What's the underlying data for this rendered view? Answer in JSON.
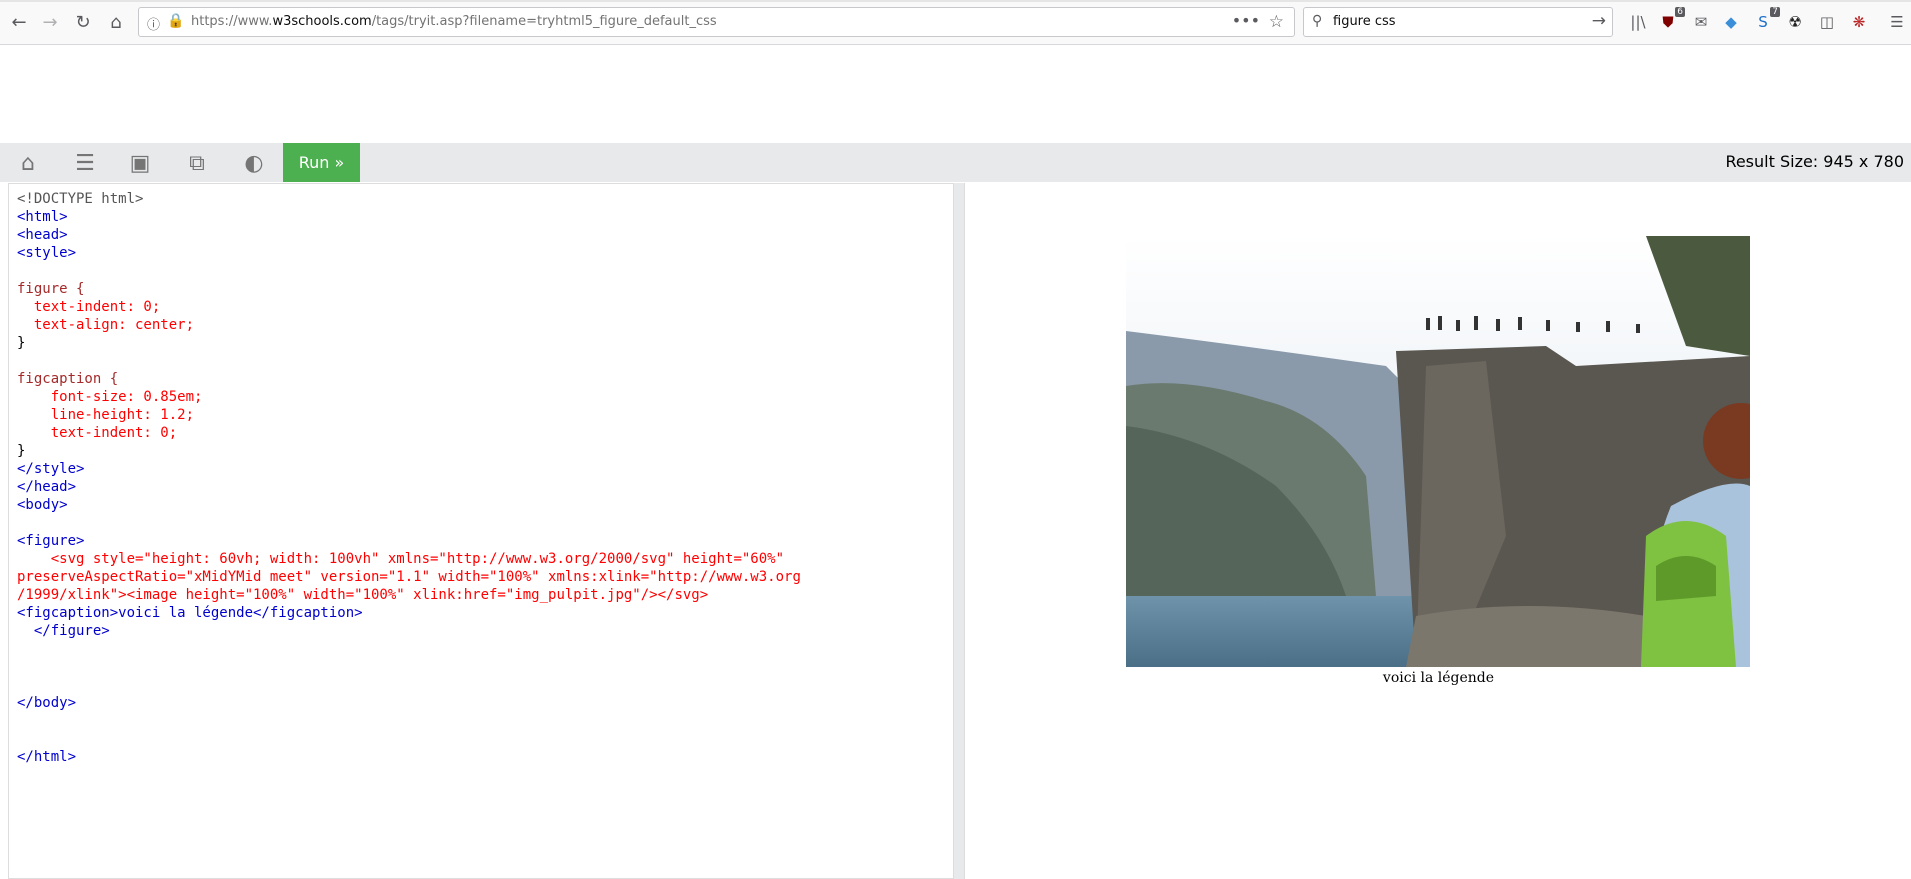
{
  "browser": {
    "url_prefix": "https://www.",
    "url_host": "w3schools.com",
    "url_path": "/tags/tryit.asp?filename=tryhtml5_figure_default_css",
    "search_query": "figure css",
    "badges": {
      "ublock": "6",
      "notifications": "7"
    }
  },
  "toolbar": {
    "run_label": "Run »",
    "result_size": "Result Size: 945 x 780"
  },
  "code_lines": [
    "<!DOCTYPE html>",
    "<html>",
    "<head>",
    "<style>",
    "",
    "figure {",
    "  text-indent: 0;",
    "  text-align: center;",
    "}",
    "",
    "figcaption {",
    "    font-size: 0.85em;",
    "    line-height: 1.2;",
    "    text-indent: 0;",
    "}",
    "</style>",
    "</head>",
    "<body>",
    "",
    "<figure>",
    "    <svg style=\"height: 60vh; width: 100vh\" xmlns=\"http://www.w3.org/2000/svg\" height=\"60%\"",
    "preserveAspectRatio=\"xMidYMid meet\" version=\"1.1\" width=\"100%\" xmlns:xlink=\"http://www.w3.org",
    "/1999/xlink\"><image height=\"100%\" width=\"100%\" xlink:href=\"img_pulpit.jpg\"/></svg>",
    "<figcaption>voici la légende</figcaption>",
    "  </figure>",
    "",
    "",
    "",
    "</body>",
    "",
    "",
    "</html>"
  ],
  "result": {
    "caption": "voici la légende"
  }
}
